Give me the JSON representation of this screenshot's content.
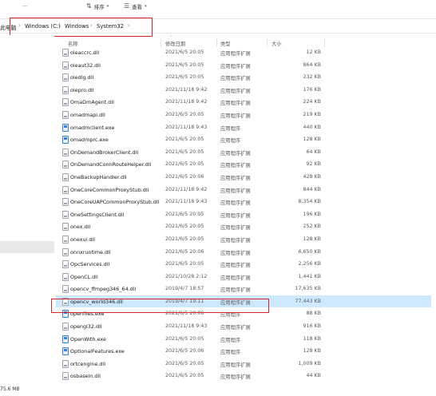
{
  "toolbar": {
    "sort_label": "排序",
    "view_label": "查看",
    "more_label": "···"
  },
  "address": {
    "root": "此电脑",
    "crumbs": [
      "Windows (C:)",
      "Windows",
      "System32"
    ]
  },
  "columns": {
    "name": "名称",
    "date": "修改日期",
    "type": "类型",
    "size": "大小"
  },
  "files": [
    {
      "name": "oleaccrc.dll",
      "date": "2021/6/5 20:05",
      "type": "应用程序扩展",
      "size": "12 KB",
      "icon": "dll-file-icon"
    },
    {
      "name": "oleaut32.dll",
      "date": "2021/6/5 20:05",
      "type": "应用程序扩展",
      "size": "864 KB",
      "icon": "dll-file-icon"
    },
    {
      "name": "oledlg.dll",
      "date": "2021/6/5 20:05",
      "type": "应用程序扩展",
      "size": "232 KB",
      "icon": "dll-file-icon"
    },
    {
      "name": "olepro.dll",
      "date": "2021/11/18 9:42",
      "type": "应用程序扩展",
      "size": "176 KB",
      "icon": "dll-file-icon"
    },
    {
      "name": "OmaDmAgent.dll",
      "date": "2021/11/18 9:42",
      "type": "应用程序扩展",
      "size": "224 KB",
      "icon": "dll-file-icon"
    },
    {
      "name": "omadmapi.dll",
      "date": "2021/6/5 20:05",
      "type": "应用程序扩展",
      "size": "219 KB",
      "icon": "dll-file-icon"
    },
    {
      "name": "omadmclient.exe",
      "date": "2021/11/18 9:43",
      "type": "应用程序",
      "size": "440 KB",
      "icon": "exe-file-icon"
    },
    {
      "name": "omadmprc.exe",
      "date": "2021/6/5 20:05",
      "type": "应用程序",
      "size": "128 KB",
      "icon": "exe-file-icon"
    },
    {
      "name": "OnDemandBrokerClient.dll",
      "date": "2021/6/5 20:05",
      "type": "应用程序扩展",
      "size": "64 KB",
      "icon": "dll-file-icon"
    },
    {
      "name": "OnDemandConnRouteHelper.dll",
      "date": "2021/6/5 20:05",
      "type": "应用程序扩展",
      "size": "92 KB",
      "icon": "dll-file-icon"
    },
    {
      "name": "OneBackupHandler.dll",
      "date": "2021/6/5 20:06",
      "type": "应用程序扩展",
      "size": "428 KB",
      "icon": "dll-file-icon"
    },
    {
      "name": "OneCoreCommonProxyStub.dll",
      "date": "2021/11/18 9:42",
      "type": "应用程序扩展",
      "size": "844 KB",
      "icon": "dll-file-icon"
    },
    {
      "name": "OneCoreUAPCommonProxyStub.dll",
      "date": "2021/11/18 9:43",
      "type": "应用程序扩展",
      "size": "8,354 KB",
      "icon": "dll-file-icon"
    },
    {
      "name": "OneSettingsClient.dll",
      "date": "2021/6/5 20:05",
      "type": "应用程序扩展",
      "size": "196 KB",
      "icon": "dll-file-icon"
    },
    {
      "name": "onex.dll",
      "date": "2021/6/5 20:05",
      "type": "应用程序扩展",
      "size": "252 KB",
      "icon": "dll-file-icon"
    },
    {
      "name": "onexui.dll",
      "date": "2021/6/5 20:05",
      "type": "应用程序扩展",
      "size": "128 KB",
      "icon": "dll-file-icon"
    },
    {
      "name": "onnxruntime.dll",
      "date": "2021/6/5 20:06",
      "type": "应用程序扩展",
      "size": "6,650 KB",
      "icon": "dll-file-icon"
    },
    {
      "name": "OpcServices.dll",
      "date": "2021/6/5 20:05",
      "type": "应用程序扩展",
      "size": "2,256 KB",
      "icon": "dll-file-icon"
    },
    {
      "name": "OpenCL.dll",
      "date": "2021/10/28 2:12",
      "type": "应用程序扩展",
      "size": "1,441 KB",
      "icon": "dll-file-icon"
    },
    {
      "name": "opencv_ffmpeg346_64.dll",
      "date": "2019/4/7 18:57",
      "type": "应用程序扩展",
      "size": "17,635 KB",
      "icon": "dll-file-icon"
    },
    {
      "name": "opencv_world346.dll",
      "date": "2019/4/7 19:11",
      "type": "应用程序扩展",
      "size": "77,443 KB",
      "icon": "dll-file-icon",
      "selected": true
    },
    {
      "name": "openfiles.exe",
      "date": "2021/6/5 20:06",
      "type": "应用程序",
      "size": "88 KB",
      "icon": "exe-file-icon"
    },
    {
      "name": "opengl32.dll",
      "date": "2021/11/18 9:43",
      "type": "应用程序扩展",
      "size": "916 KB",
      "icon": "dll-file-icon"
    },
    {
      "name": "OpenWith.exe",
      "date": "2021/6/5 20:05",
      "type": "应用程序",
      "size": "118 KB",
      "icon": "exe-file-icon"
    },
    {
      "name": "OptionalFeatures.exe",
      "date": "2021/6/5 20:06",
      "type": "应用程序",
      "size": "128 KB",
      "icon": "exe-file-icon"
    },
    {
      "name": "ortcengine.dll",
      "date": "2021/6/5 20:05",
      "type": "应用程序扩展",
      "size": "1,009 KB",
      "icon": "dll-file-icon"
    },
    {
      "name": "osbaseln.dll",
      "date": "2021/6/5 20:05",
      "type": "应用程序扩展",
      "size": "44 KB",
      "icon": "dll-file-icon"
    }
  ],
  "status": {
    "selected_size": "75.6 MB"
  }
}
